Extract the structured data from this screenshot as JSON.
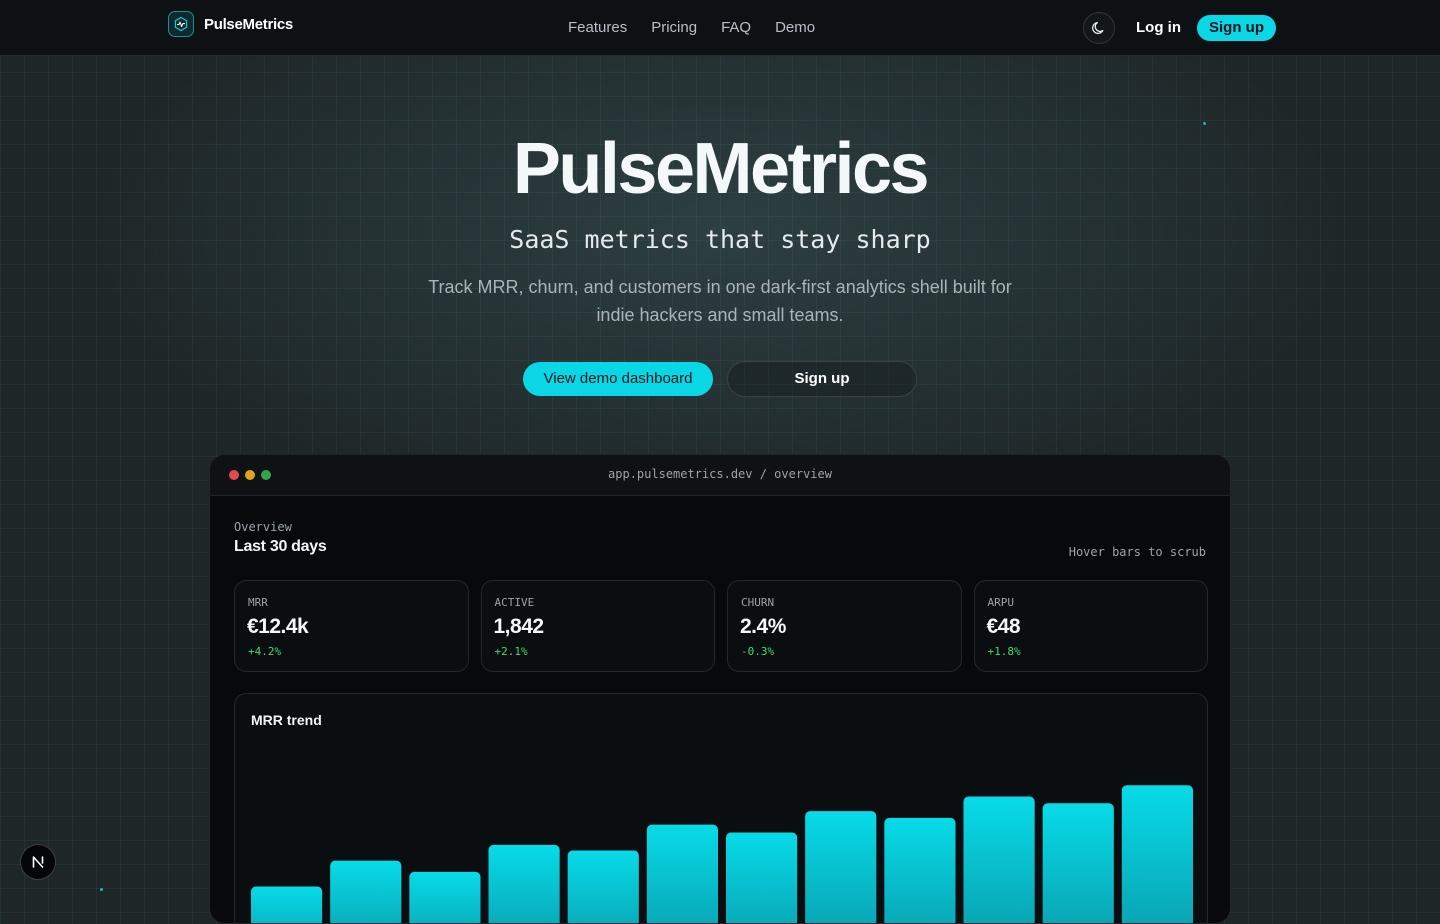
{
  "nav": {
    "brand": "PulseMetrics",
    "links": [
      "Features",
      "Pricing",
      "FAQ",
      "Demo"
    ],
    "login": "Log in",
    "signup": "Sign up"
  },
  "hero": {
    "title": "PulseMetrics",
    "subtitle": "SaaS metrics that stay sharp",
    "description": "Track MRR, churn, and customers in one dark-first analytics shell built for indie hackers and small teams.",
    "primary_cta": "View demo dashboard",
    "secondary_cta": "Sign up"
  },
  "window": {
    "url": "app.pulsemetrics.dev / overview",
    "overview_label": "Overview",
    "period": "Last 30 days",
    "hint": "Hover bars to scrub",
    "kpis": [
      {
        "label": "MRR",
        "value": "€12.4k",
        "delta": "+4.2%"
      },
      {
        "label": "ACTIVE",
        "value": "1,842",
        "delta": "+2.1%"
      },
      {
        "label": "CHURN",
        "value": "2.4%",
        "delta": "-0.3%"
      },
      {
        "label": "ARPU",
        "value": "€48",
        "delta": "+1.8%"
      }
    ],
    "trend_title": "MRR trend"
  },
  "colors": {
    "accent": "#0ad7e5",
    "positive": "#3ddc6f",
    "page_bg": "#1f2628",
    "window_bg": "#07090b"
  },
  "icons": {
    "brand": "pulse-logo-icon",
    "theme": "moon-icon",
    "badge": "nextjs-n-icon"
  },
  "chart_data": {
    "type": "bar",
    "title": "MRR trend",
    "values": [
      60,
      83,
      73,
      97,
      92,
      115,
      108,
      127,
      121,
      140,
      134,
      150
    ],
    "ylim": [
      0,
      160
    ]
  }
}
